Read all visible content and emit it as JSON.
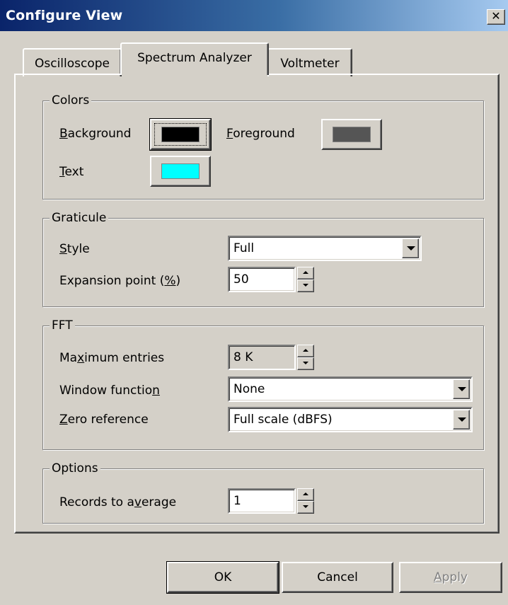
{
  "window": {
    "title": "Configure View",
    "close_glyph": "✕"
  },
  "tabs": [
    {
      "label": "Oscilloscope",
      "active": false
    },
    {
      "label": "Spectrum Analyzer",
      "active": true
    },
    {
      "label": "Voltmeter",
      "active": false
    }
  ],
  "colors": {
    "group_label": "Colors",
    "background": {
      "label": "Background",
      "mnemonic": "B",
      "rest": "ackground",
      "swatch": "#000000"
    },
    "foreground": {
      "label": "Foreground",
      "mnemonic": "F",
      "rest": "oreground",
      "swatch": "#555555"
    },
    "text": {
      "label": "Text",
      "mnemonic": "T",
      "rest": "ext",
      "swatch": "#00ffff"
    }
  },
  "graticule": {
    "group_label": "Graticule",
    "style_label_mn": "S",
    "style_label_rest": "tyle",
    "style_value": "Full",
    "expansion_label_pre": "Expansion point (",
    "expansion_label_mn": "%",
    "expansion_label_post": ")",
    "expansion_value": "50"
  },
  "fft": {
    "group_label": "FFT",
    "max_label_pre": "Ma",
    "max_label_mn": "x",
    "max_label_post": "imum entries",
    "max_value": "8 K",
    "window_label_pre": "Window functio",
    "window_label_mn": "n",
    "window_value": "None",
    "zero_label_mn": "Z",
    "zero_label_rest": "ero reference",
    "zero_value": "Full scale (dBFS)"
  },
  "options": {
    "group_label": "Options",
    "records_label_pre": "Records to a",
    "records_label_mn": "v",
    "records_label_post": "erage",
    "records_value": "1"
  },
  "buttons": {
    "ok": "OK",
    "cancel": "Cancel",
    "apply_mn": "A",
    "apply_rest": "pply"
  }
}
